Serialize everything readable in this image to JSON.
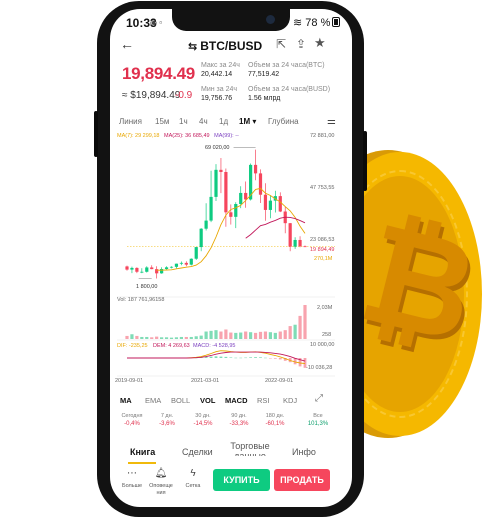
{
  "status_bar": {
    "time": "10:33",
    "battery": "78 %"
  },
  "header": {
    "pair": "BTC/BUSD"
  },
  "ticker": {
    "last_price": "19,894.49",
    "usd_price": "≈ $19,894.49",
    "change": "-0.9",
    "high_label": "Макс за 24ч",
    "high_value": "20,442.14",
    "low_label": "Мин за 24ч",
    "low_value": "19,756.76",
    "vol_btc_label": "Объем за 24 часа(BTC)",
    "vol_btc_value": "77,519.42",
    "vol_busd_label": "Объем за 24 часа(BUSD)",
    "vol_busd_value": "1.56 млрд"
  },
  "timeframes": {
    "line": "Линия",
    "m15": "15м",
    "h1": "1ч",
    "h4": "4ч",
    "d1": "1д",
    "mo1": "1M ▾",
    "depth": "Глубина"
  },
  "chart_overlay": {
    "ma7": "MA(7): 29 299,18",
    "ma25": "MA(25): 36 685,49",
    "ma99": "MA(99): --",
    "peak_label": "69 020,00",
    "low_label": "1 800,00",
    "vol_label": "Vol: 187 761,96158",
    "dif": "DIF: -235,25",
    "dem": "DEM: 4 269,63",
    "macd": "MACD: -4 528,95"
  },
  "axis": {
    "p1": "72 881,00",
    "p2": "47 753,55",
    "p3": "23 086,53",
    "p_last": "19 894,49",
    "p4": "270,1M",
    "v1": "2,03M",
    "v2": "258",
    "m1": "10 000,00",
    "m2": "-10 036,28",
    "d1": "2019-09-01",
    "d2": "2021-03-01",
    "d3": "2022-09-01"
  },
  "indicators": [
    "MA",
    "EMA",
    "BOLL",
    "VOL",
    "MACD",
    "RSI",
    "KDJ"
  ],
  "performance": [
    {
      "label": "Сегодня",
      "value": "-0,4%"
    },
    {
      "label": "7 дн.",
      "value": "-3,6%"
    },
    {
      "label": "30 дн.",
      "value": "-14,5%"
    },
    {
      "label": "90 дн.",
      "value": "-33,3%"
    },
    {
      "label": "180 дн.",
      "value": "-60,1%"
    },
    {
      "label": "Все",
      "value": "101,3%"
    }
  ],
  "bottom_tabs": {
    "book": "Книга",
    "deals": "Сделки",
    "trading": "Торговые данные",
    "info": "Инфо"
  },
  "bottom_bar": {
    "more": "Больше",
    "alerts": "Оповеще ния",
    "grid": "Сетка",
    "buy": "КУПИТЬ",
    "sell": "ПРОДАТЬ"
  },
  "chart_data": {
    "type": "candlestick",
    "candles": [
      {
        "o": 9900,
        "h": 10300,
        "l": 7800,
        "c": 8300
      },
      {
        "o": 8300,
        "h": 9800,
        "l": 6500,
        "c": 9150
      },
      {
        "o": 9150,
        "h": 9500,
        "l": 6500,
        "c": 7200
      },
      {
        "o": 7200,
        "h": 9000,
        "l": 6500,
        "c": 7200
      },
      {
        "o": 7200,
        "h": 10000,
        "l": 6800,
        "c": 9400
      },
      {
        "o": 9400,
        "h": 10500,
        "l": 8500,
        "c": 8550
      },
      {
        "o": 8550,
        "h": 10000,
        "l": 3800,
        "c": 6400
      },
      {
        "o": 6400,
        "h": 9500,
        "l": 6200,
        "c": 8600
      },
      {
        "o": 8600,
        "h": 10000,
        "l": 8100,
        "c": 9450
      },
      {
        "o": 9450,
        "h": 10000,
        "l": 8900,
        "c": 9700
      },
      {
        "o": 9700,
        "h": 11300,
        "l": 8900,
        "c": 11300
      },
      {
        "o": 11300,
        "h": 12400,
        "l": 10500,
        "c": 11700
      },
      {
        "o": 11700,
        "h": 12500,
        "l": 10000,
        "c": 10800
      },
      {
        "o": 10800,
        "h": 14000,
        "l": 10400,
        "c": 13800
      },
      {
        "o": 13800,
        "h": 19800,
        "l": 13200,
        "c": 19700
      },
      {
        "o": 19700,
        "h": 29300,
        "l": 17600,
        "c": 29000
      },
      {
        "o": 29000,
        "h": 41900,
        "l": 28100,
        "c": 33100
      },
      {
        "o": 33100,
        "h": 58300,
        "l": 32300,
        "c": 45100
      },
      {
        "o": 45100,
        "h": 61700,
        "l": 43000,
        "c": 58800
      },
      {
        "o": 58800,
        "h": 64800,
        "l": 47000,
        "c": 57700
      },
      {
        "o": 57700,
        "h": 59500,
        "l": 30000,
        "c": 37300
      },
      {
        "o": 37300,
        "h": 41300,
        "l": 31100,
        "c": 35000
      },
      {
        "o": 35000,
        "h": 42400,
        "l": 29300,
        "c": 41500
      },
      {
        "o": 41500,
        "h": 50500,
        "l": 39400,
        "c": 47100
      },
      {
        "o": 47100,
        "h": 52900,
        "l": 39600,
        "c": 43800
      },
      {
        "o": 43800,
        "h": 62000,
        "l": 43300,
        "c": 61300
      },
      {
        "o": 61300,
        "h": 69000,
        "l": 53500,
        "c": 57000
      },
      {
        "o": 57000,
        "h": 59000,
        "l": 42000,
        "c": 46200
      },
      {
        "o": 46200,
        "h": 52000,
        "l": 33000,
        "c": 38500
      },
      {
        "o": 38500,
        "h": 45800,
        "l": 34300,
        "c": 43200
      },
      {
        "o": 43200,
        "h": 48200,
        "l": 37200,
        "c": 45500
      },
      {
        "o": 45500,
        "h": 47400,
        "l": 37400,
        "c": 37700
      },
      {
        "o": 37700,
        "h": 40000,
        "l": 26700,
        "c": 31800
      },
      {
        "o": 31800,
        "h": 31900,
        "l": 17600,
        "c": 19900
      },
      {
        "o": 19900,
        "h": 24700,
        "l": 18800,
        "c": 23300
      },
      {
        "o": 23300,
        "h": 25200,
        "l": 19600,
        "c": 20100
      },
      {
        "o": 20100,
        "h": 20500,
        "l": 19700,
        "c": 19894
      }
    ],
    "ylim": [
      0,
      72881
    ],
    "ma7": [
      null,
      null,
      null,
      null,
      null,
      null,
      8000,
      8000,
      8100,
      8200,
      8700,
      9100,
      9500,
      9800,
      10600,
      12300,
      15300,
      19400,
      24800,
      31000,
      35900,
      38700,
      39600,
      40800,
      43300,
      45900,
      48900,
      49400,
      47000,
      45800,
      44100,
      42500,
      40200,
      38000,
      34700,
      30200,
      26600
    ],
    "ma25": [
      null,
      null,
      null,
      null,
      null,
      null,
      null,
      null,
      null,
      null,
      null,
      null,
      null,
      null,
      null,
      null,
      null,
      null,
      null,
      null,
      null,
      null,
      null,
      null,
      24200,
      26000,
      28300,
      30500,
      31200,
      32300,
      33200,
      34300,
      34800,
      34700,
      34100,
      33100,
      32000
    ],
    "volume": [
      0.09,
      0.14,
      0.09,
      0.06,
      0.06,
      0.05,
      0.07,
      0.05,
      0.05,
      0.04,
      0.05,
      0.06,
      0.06,
      0.06,
      0.08,
      0.1,
      0.22,
      0.24,
      0.26,
      0.22,
      0.28,
      0.19,
      0.18,
      0.19,
      0.22,
      0.2,
      0.18,
      0.21,
      0.22,
      0.2,
      0.18,
      0.22,
      0.26,
      0.38,
      0.42,
      0.68,
      1.0
    ],
    "macd_hist": [
      0,
      0,
      0,
      0,
      0,
      0,
      0,
      0,
      0,
      0,
      0,
      0,
      0,
      0,
      0.02,
      0.04,
      0.08,
      0.1,
      0.12,
      0.1,
      0.08,
      0.04,
      0.02,
      0.02,
      0.03,
      0.05,
      0.06,
      0.05,
      0.02,
      -0.02,
      -0.05,
      -0.1,
      -0.2,
      -0.3,
      -0.45,
      -0.6,
      -0.7
    ],
    "dif_line": [
      0,
      0,
      0,
      0,
      0,
      0,
      0,
      0,
      0,
      0,
      0,
      0,
      0,
      0.02,
      0.05,
      0.1,
      0.2,
      0.32,
      0.45,
      0.52,
      0.5,
      0.46,
      0.42,
      0.4,
      0.4,
      0.42,
      0.44,
      0.4,
      0.34,
      0.26,
      0.18,
      0.08,
      -0.04,
      -0.18,
      -0.28,
      -0.36,
      -0.4
    ],
    "dem_line": [
      0,
      0,
      0,
      0,
      0,
      0,
      0,
      0,
      0,
      0,
      0,
      0,
      0,
      0.01,
      0.02,
      0.05,
      0.1,
      0.18,
      0.27,
      0.34,
      0.39,
      0.42,
      0.42,
      0.42,
      0.42,
      0.42,
      0.42,
      0.42,
      0.4,
      0.37,
      0.33,
      0.28,
      0.2,
      0.1,
      -0.02,
      -0.12,
      -0.22
    ]
  }
}
